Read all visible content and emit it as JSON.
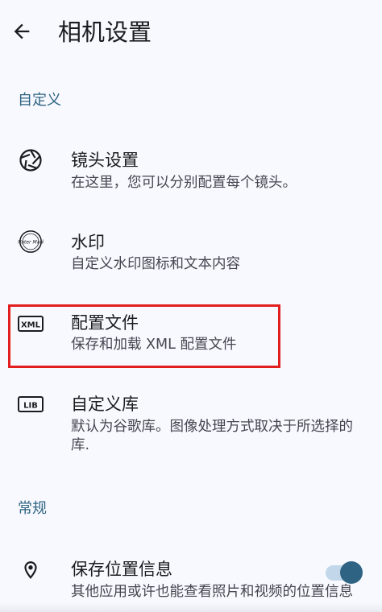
{
  "header": {
    "title": "相机设置"
  },
  "sections": {
    "custom": "自定义",
    "general": "常规"
  },
  "items": {
    "lens": {
      "title": "镜头设置",
      "summary": "在这里，您可以分别配置每个镜头。",
      "icon": "camera-aperture-icon"
    },
    "watermark": {
      "title": "水印",
      "summary": "自定义水印图标和文本内容",
      "icon": "watermark-logo-icon",
      "icon_text": "Water Mark"
    },
    "config_file": {
      "title": "配置文件",
      "summary": "保存和加载 XML 配置文件",
      "icon": "xml-file-icon",
      "icon_text": "XML"
    },
    "custom_lib": {
      "title": "自定义库",
      "summary": "默认为谷歌库。图像处理方式取决于所选择的库.",
      "icon": "lib-icon",
      "icon_text": "LIB"
    },
    "location": {
      "title": "保存位置信息",
      "summary": "其他应用或许也能查看照片和视频的位置信息",
      "icon": "location-pin-icon",
      "enabled": true
    }
  },
  "colors": {
    "accent": "#2e6383",
    "highlight": "#e21e1e",
    "background": "#f8f9fe"
  }
}
